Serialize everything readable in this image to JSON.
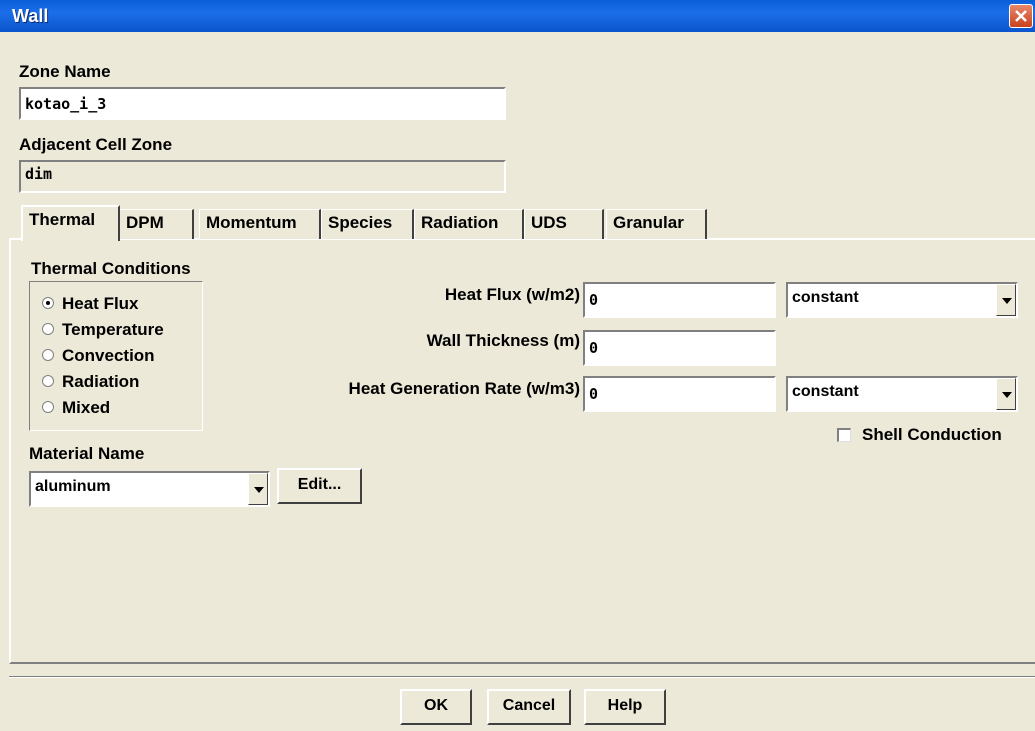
{
  "window": {
    "title": "Wall"
  },
  "zone": {
    "zone_name_label": "Zone Name",
    "zone_name_value": "kotao_i_3",
    "adjacent_label": "Adjacent Cell Zone",
    "adjacent_value": "dim"
  },
  "tabs": [
    {
      "label": "Thermal",
      "active": true
    },
    {
      "label": "DPM"
    },
    {
      "label": "Momentum"
    },
    {
      "label": "Species"
    },
    {
      "label": "Radiation"
    },
    {
      "label": "UDS"
    },
    {
      "label": "Granular"
    }
  ],
  "thermal": {
    "conditions_label": "Thermal Conditions",
    "options": [
      "Heat Flux",
      "Temperature",
      "Convection",
      "Radiation",
      "Mixed"
    ],
    "selected": "Heat Flux",
    "heat_flux_label": "Heat Flux (w/m2)",
    "heat_flux_value": "0",
    "heat_flux_profile": "constant",
    "wall_thickness_label": "Wall Thickness (m)",
    "wall_thickness_value": "0",
    "heat_gen_label": "Heat Generation Rate (w/m3)",
    "heat_gen_value": "0",
    "heat_gen_profile": "constant",
    "shell_conduction_label": "Shell Conduction",
    "material_label": "Material Name",
    "material_value": "aluminum",
    "edit_label": "Edit..."
  },
  "buttons": {
    "ok": "OK",
    "cancel": "Cancel",
    "help": "Help"
  },
  "colors": {
    "titlebar": "#0b55cc",
    "face": "#ece9d8",
    "close": "#c9421d"
  }
}
